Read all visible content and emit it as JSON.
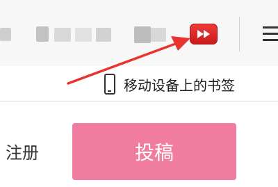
{
  "toolbar": {
    "extension_icon": "video-fast-forward-icon",
    "extension_color": "#e02424",
    "menu_icon": "hamburger-menu-icon"
  },
  "bookmarks_bar": {
    "mobile_bookmarks_icon": "mobile-phone-icon",
    "mobile_bookmarks_label": "移动设备上的书签"
  },
  "header": {
    "register_label": "注册",
    "submit_label": "投稿",
    "submit_color": "#f07c9f"
  },
  "annotation": {
    "arrow_color": "#e8332f"
  }
}
